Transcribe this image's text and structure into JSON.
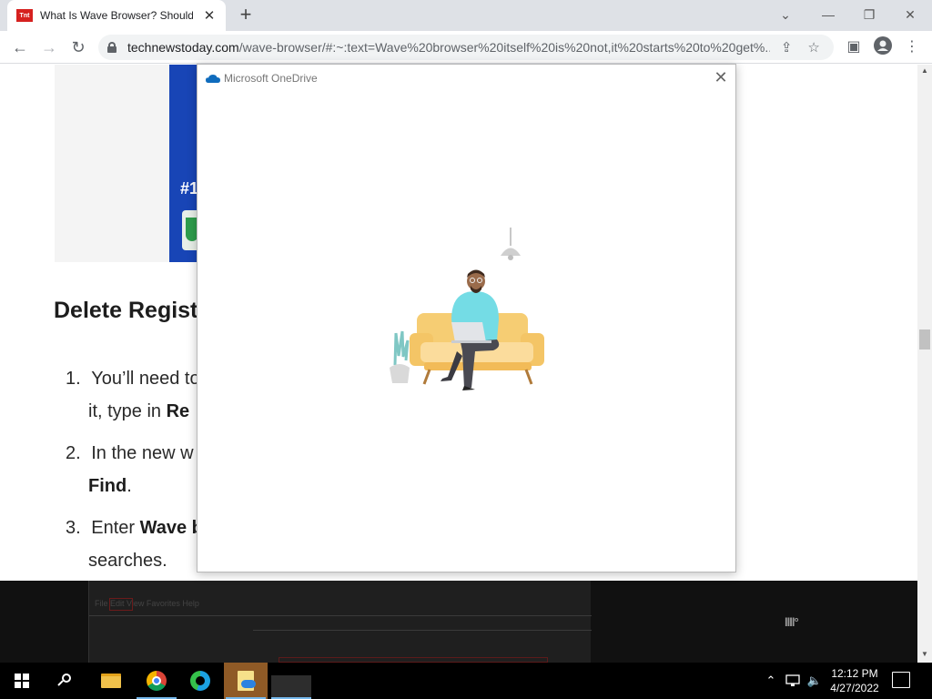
{
  "browser": {
    "tab_title": "What Is Wave Browser? Should I",
    "favicon_text": "Tnt",
    "url_host": "technewstoday.com",
    "url_rest": "/wave-browser/#:~:text=Wave%20browser%20itself%20is%20not,it%20starts%20to%20get%...",
    "icons": [
      "back-icon",
      "forward-icon",
      "reload-icon",
      "lock-icon",
      "share-icon",
      "star-icon",
      "sidepanel-icon",
      "profile-icon",
      "menu-icon"
    ]
  },
  "article": {
    "ad_text": "#1",
    "heading": "Delete Regist",
    "steps": [
      {
        "num": "1.",
        "text": "You’ll need to",
        "cont_prefix": "it, type in ",
        "cont_bold": "Re"
      },
      {
        "num": "2.",
        "text": "In the new w",
        "cont_bold": "Find",
        "cont_suffix": "."
      },
      {
        "num": "3.",
        "text_prefix": "Enter ",
        "text_bold": "Wave b",
        "cont": "searches."
      }
    ]
  },
  "video": {
    "menu_items": "File  Edit  View  Favorites  Help",
    "logo": "llll°"
  },
  "dialog": {
    "title": "Microsoft OneDrive",
    "accent": "#0f6cbd"
  },
  "taskbar": {
    "time": "12:12 PM",
    "date": "4/27/2022",
    "apps": [
      "start",
      "search",
      "file-explorer",
      "chrome",
      "edge",
      "onedrive",
      "blank-app"
    ]
  }
}
